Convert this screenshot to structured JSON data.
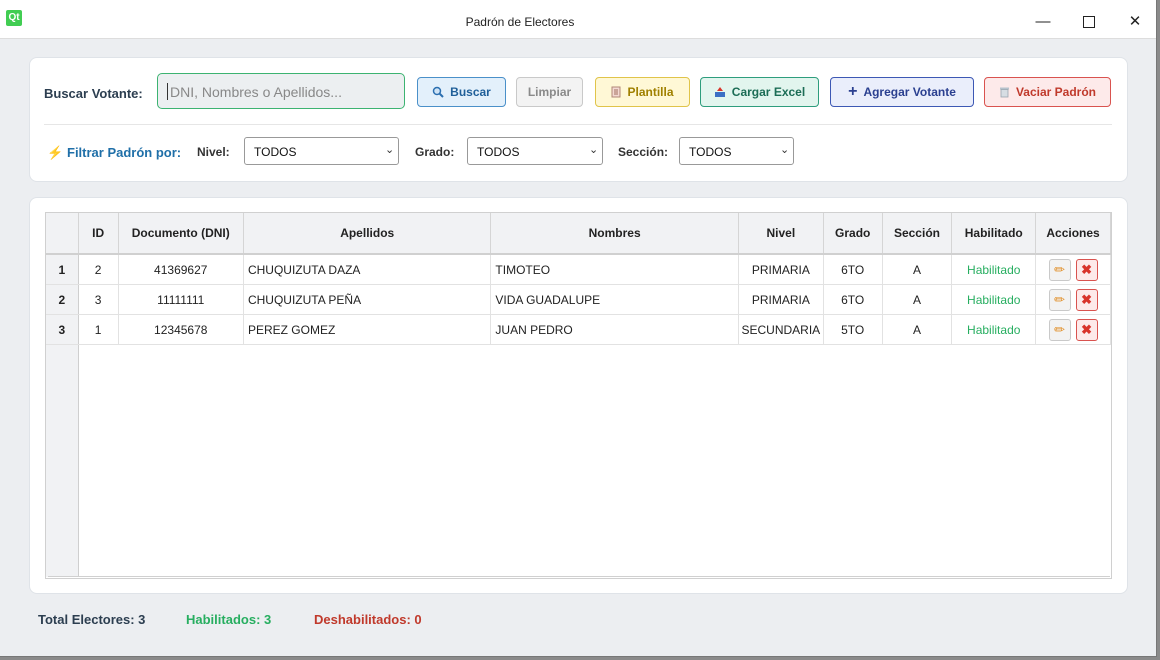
{
  "window": {
    "title": "Padrón de Electores",
    "logo": "Qt"
  },
  "search": {
    "label": "Buscar Votante:",
    "placeholder": "DNI, Nombres o Apellidos...",
    "value": ""
  },
  "toolbar": {
    "buscar": "Buscar",
    "limpiar": "Limpiar",
    "plantilla": "Plantilla",
    "cargar": "Cargar Excel",
    "agregar": "Agregar Votante",
    "vaciar": "Vaciar Padrón"
  },
  "filters": {
    "title": "Filtrar Padrón por:",
    "nivel_label": "Nivel:",
    "nivel_value": "TODOS",
    "grado_label": "Grado:",
    "grado_value": "TODOS",
    "seccion_label": "Sección:",
    "seccion_value": "TODOS"
  },
  "table": {
    "headers": [
      "ID",
      "Documento (DNI)",
      "Apellidos",
      "Nombres",
      "Nivel",
      "Grado",
      "Sección",
      "Habilitado",
      "Acciones"
    ],
    "rows": [
      {
        "row_num": "1",
        "id": "2",
        "dni": "41369627",
        "apellidos": "CHUQUIZUTA DAZA",
        "nombres": "TIMOTEO",
        "nivel": "PRIMARIA",
        "grado": "6TO",
        "seccion": "A",
        "habilitado": "Habilitado"
      },
      {
        "row_num": "2",
        "id": "3",
        "dni": "11111111",
        "apellidos": "CHUQUIZUTA PEÑA",
        "nombres": "VIDA GUADALUPE",
        "nivel": "PRIMARIA",
        "grado": "6TO",
        "seccion": "A",
        "habilitado": "Habilitado"
      },
      {
        "row_num": "3",
        "id": "1",
        "dni": "12345678",
        "apellidos": "PEREZ GOMEZ",
        "nombres": "JUAN PEDRO",
        "nivel": "SECUNDARIA",
        "grado": "5TO",
        "seccion": "A",
        "habilitado": "Habilitado"
      }
    ]
  },
  "footer": {
    "total": "Total Electores: 3",
    "habilitados": "Habilitados: 3",
    "deshabilitados": "Deshabilitados: 0"
  },
  "colors": {
    "accent": "#1f6fa8",
    "enabled": "#27ae60",
    "danger": "#c0392b"
  }
}
